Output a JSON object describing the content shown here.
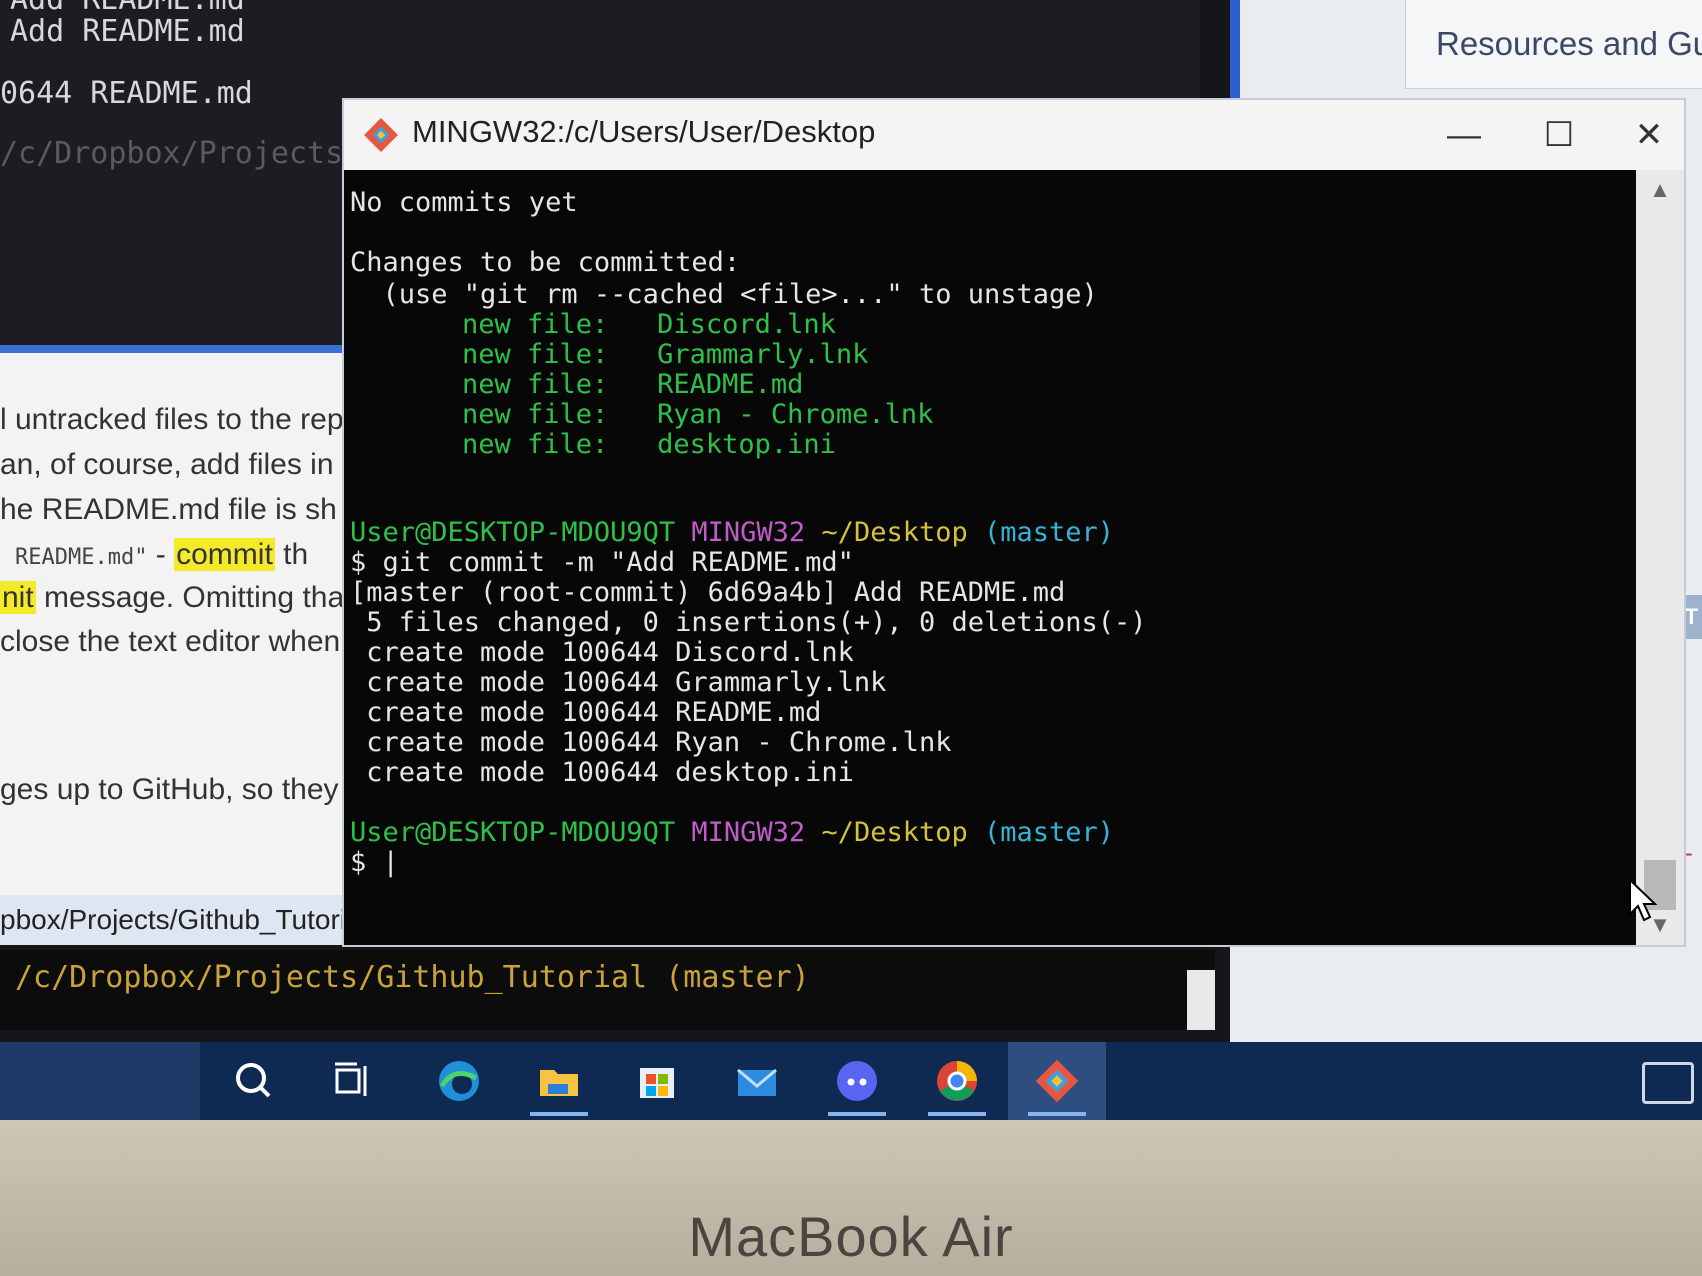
{
  "background_terminal": {
    "lines": [
      "Add README.md",
      "Add README.md",
      "0644 README.md",
      "/c/Dropbox/Projects"
    ]
  },
  "right_panel": {
    "tab_title": "Resources and Gu",
    "badge": "ST",
    "side_label": "BY-"
  },
  "tutorial_doc": {
    "lines": [
      "l untracked files to the rep",
      "an, of course, add files in",
      "he README.md file is sh"
    ],
    "code_snippet": "README.md\"",
    "dash": " - ",
    "highlight": "commit",
    "after_highlight": " th",
    "line5_highlight": "nit",
    "line5_rest": " message. Omitting tha",
    "line6": "close the text editor when",
    "line7": "ges up to GitHub, so they",
    "path_bar": "pbox/Projects/Github_Tutorial"
  },
  "bottom_terminal": {
    "line": "/c/Dropbox/Projects/Github_Tutorial (master)"
  },
  "window": {
    "title": "MINGW32:/c/Users/User/Desktop",
    "minimize": "—",
    "maximize": "☐",
    "close": "✕"
  },
  "console": {
    "status_header": "No commits yet",
    "changes_header": "Changes to be committed:",
    "unstage_hint": "  (use \"git rm --cached <file>...\" to unstage)",
    "staged": [
      {
        "label": "new file:",
        "file": "Discord.lnk"
      },
      {
        "label": "new file:",
        "file": "Grammarly.lnk"
      },
      {
        "label": "new file:",
        "file": "README.md"
      },
      {
        "label": "new file:",
        "file": "Ryan - Chrome.lnk"
      },
      {
        "label": "new file:",
        "file": "desktop.ini"
      }
    ],
    "prompt": {
      "user": "User@DESKTOP-MDOU9QT",
      "host": "MINGW32",
      "path": "~/Desktop",
      "branch": "(master)"
    },
    "command": "$ git commit -m \"Add README.md\"",
    "commit_result": "[master (root-commit) 6d69a4b] Add README.md",
    "summary": " 5 files changed, 0 insertions(+), 0 deletions(-)",
    "create_lines": [
      " create mode 100644 Discord.lnk",
      " create mode 100644 Grammarly.lnk",
      " create mode 100644 README.md",
      " create mode 100644 Ryan - Chrome.lnk",
      " create mode 100644 desktop.ini"
    ],
    "cursor_prompt": "$ |"
  },
  "taskbar": {
    "icons": [
      "search-icon",
      "task-view-icon",
      "edge-icon",
      "file-explorer-icon",
      "store-icon",
      "mail-icon",
      "discord-icon",
      "chrome-icon",
      "git-bash-icon"
    ],
    "active": "git-bash-icon"
  },
  "bezel": {
    "brand": "MacBook Air"
  },
  "colors": {
    "console_green": "#2fc04a",
    "console_magenta": "#c05cc8",
    "console_yellow": "#d6c23a",
    "console_cyan": "#35b5d6",
    "taskbar": "#0f2a52"
  }
}
